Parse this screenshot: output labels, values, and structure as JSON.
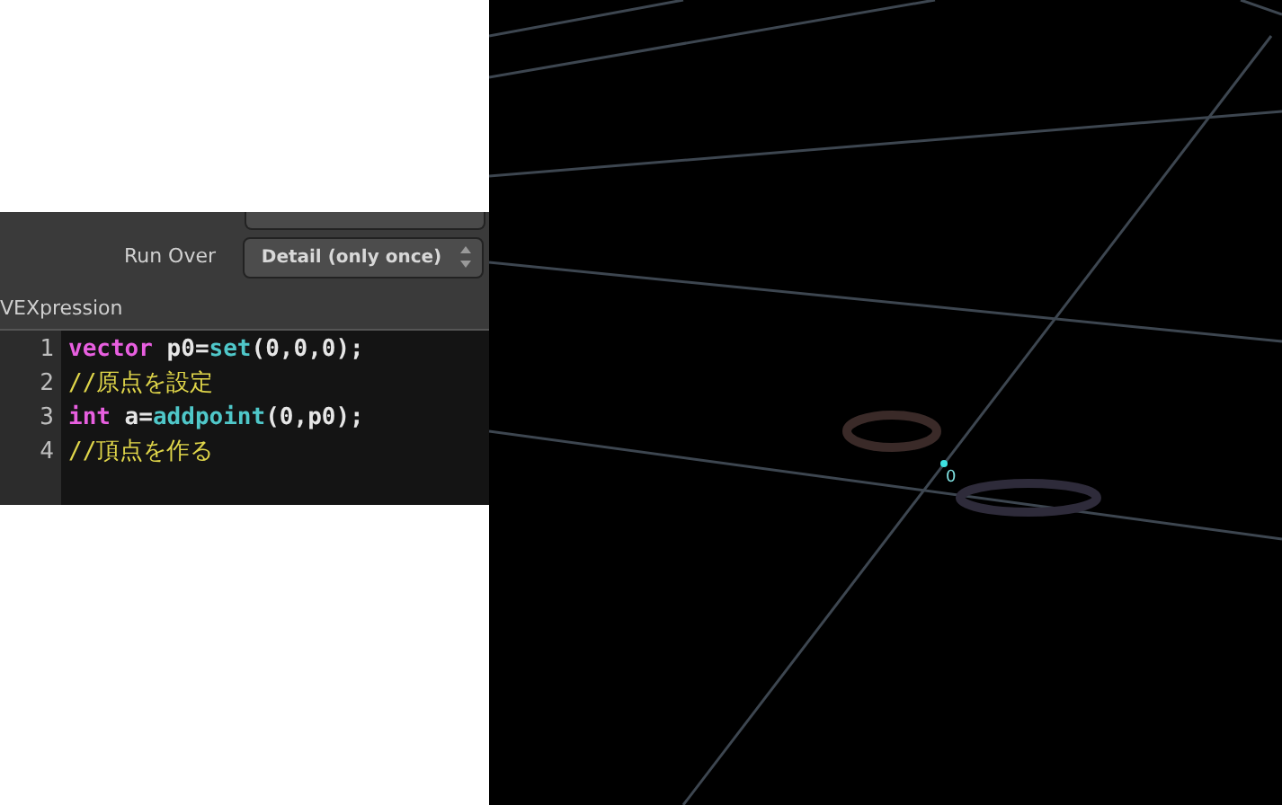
{
  "parameters": {
    "run_over": {
      "label": "Run Over",
      "value": "Detail (only once)"
    }
  },
  "editor": {
    "title": "VEXpression",
    "lines": [
      {
        "number": "1",
        "tokens": [
          {
            "kind": "keyword",
            "text": "vector"
          },
          {
            "kind": "plain",
            "text": " p0="
          },
          {
            "kind": "function",
            "text": "set"
          },
          {
            "kind": "plain",
            "text": "(0,0,0);"
          }
        ]
      },
      {
        "number": "2",
        "tokens": [
          {
            "kind": "comment",
            "text": "//原点を設定"
          }
        ]
      },
      {
        "number": "3",
        "tokens": [
          {
            "kind": "keyword",
            "text": "int"
          },
          {
            "kind": "plain",
            "text": " a="
          },
          {
            "kind": "function",
            "text": "addpoint"
          },
          {
            "kind": "plain",
            "text": "(0,p0);"
          }
        ]
      },
      {
        "number": "4",
        "tokens": [
          {
            "kind": "comment",
            "text": "//頂点を作る"
          }
        ]
      }
    ]
  },
  "viewport": {
    "point_label": "0"
  }
}
